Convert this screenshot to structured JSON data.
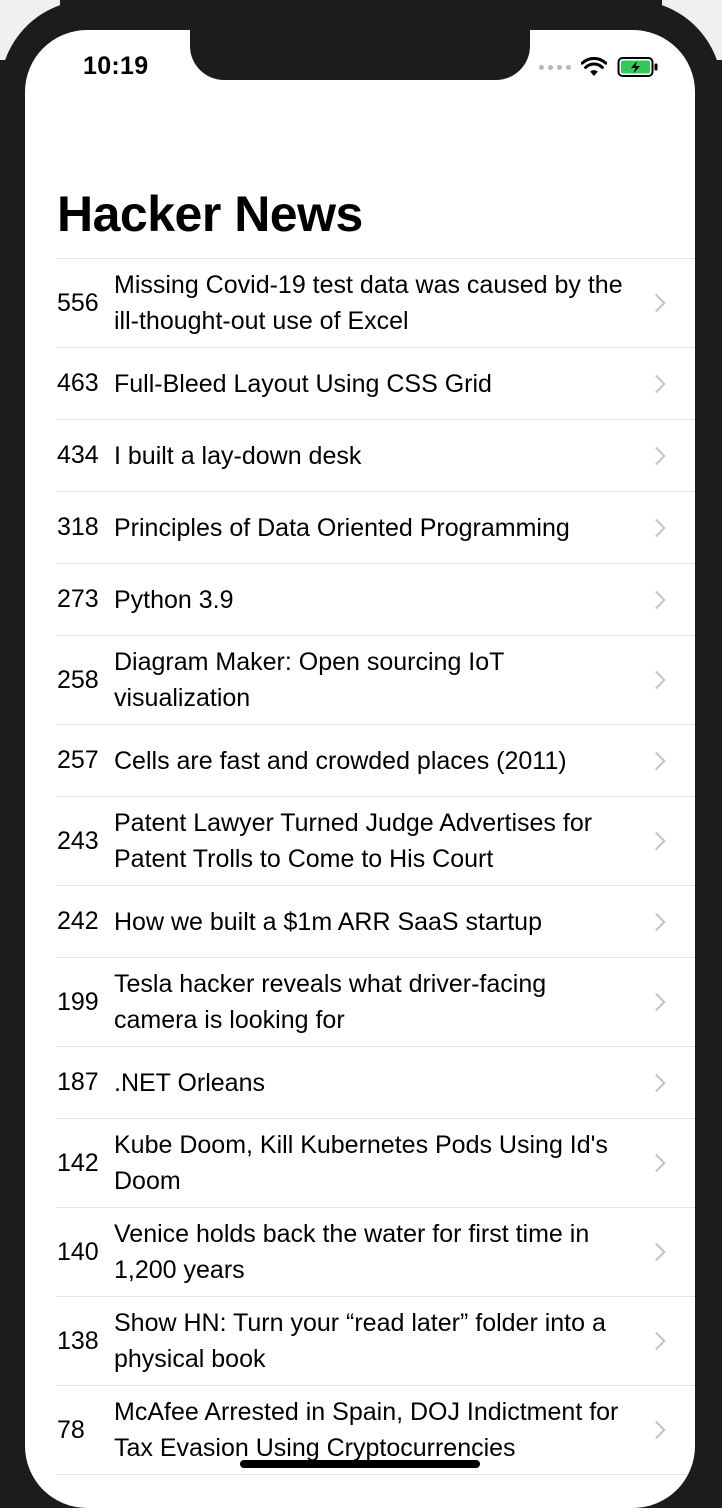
{
  "status_bar": {
    "time": "10:19"
  },
  "nav": {
    "title": "Hacker News"
  },
  "stories": [
    {
      "score": "556",
      "title": "Missing Covid-19 test data was caused by the ill-thought-out use of Excel",
      "lines": 2
    },
    {
      "score": "463",
      "title": "Full-Bleed Layout Using CSS Grid",
      "lines": 1
    },
    {
      "score": "434",
      "title": "I built a lay-down desk",
      "lines": 1
    },
    {
      "score": "318",
      "title": "Principles of Data Oriented Programming",
      "lines": 1
    },
    {
      "score": "273",
      "title": "Python 3.9",
      "lines": 1
    },
    {
      "score": "258",
      "title": "Diagram Maker: Open sourcing IoT visualization",
      "lines": 2
    },
    {
      "score": "257",
      "title": "Cells are fast and crowded places (2011)",
      "lines": 1
    },
    {
      "score": "243",
      "title": "Patent Lawyer Turned Judge Advertises for Patent Trolls to Come to His Court",
      "lines": 2
    },
    {
      "score": "242",
      "title": "How we built a $1m ARR SaaS startup",
      "lines": 1
    },
    {
      "score": "199",
      "title": "Tesla hacker reveals what driver-facing camera is looking for",
      "lines": 2
    },
    {
      "score": "187",
      "title": ".NET Orleans",
      "lines": 1
    },
    {
      "score": "142",
      "title": "Kube Doom, Kill Kubernetes Pods Using Id's Doom",
      "lines": 2
    },
    {
      "score": "140",
      "title": "Venice holds back the water for first time in 1,200 years",
      "lines": 2
    },
    {
      "score": "138",
      "title": "Show HN: Turn your “read later” folder into a physical book",
      "lines": 2
    },
    {
      "score": "78",
      "title": "McAfee Arrested in Spain, DOJ Indictment for Tax Evasion Using Cryptocurrencies",
      "lines": 2
    }
  ]
}
